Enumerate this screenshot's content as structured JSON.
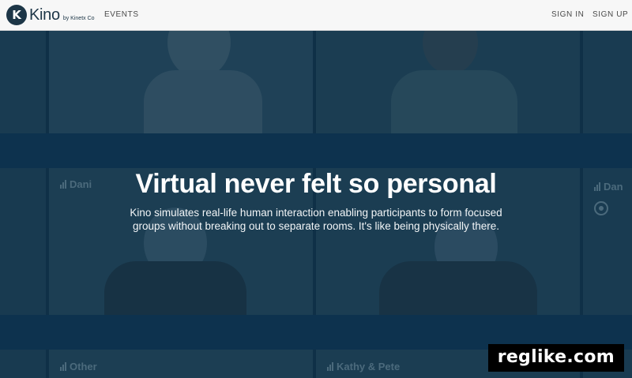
{
  "nav": {
    "logo_letter": "K",
    "logo_word": "Kino",
    "logo_by": "by Kinetx Co",
    "events": "EVENTS",
    "sign_in": "SIGN IN",
    "sign_up": "SIGN UP"
  },
  "tiles": {
    "daniel_left": "Dani",
    "daniel_right": "Dan",
    "other": "Other",
    "kathy": "Kathy & Pete"
  },
  "hero": {
    "headline": "Virtual never felt so personal",
    "subtext": "Kino simulates real-life human interaction enabling participants to form focused groups without breaking out to separate rooms. It's like being physically there."
  },
  "watermark": "reglike.com",
  "colors": {
    "background": "#0f3247",
    "band": "#0d3550",
    "logo": "#1d3647"
  }
}
